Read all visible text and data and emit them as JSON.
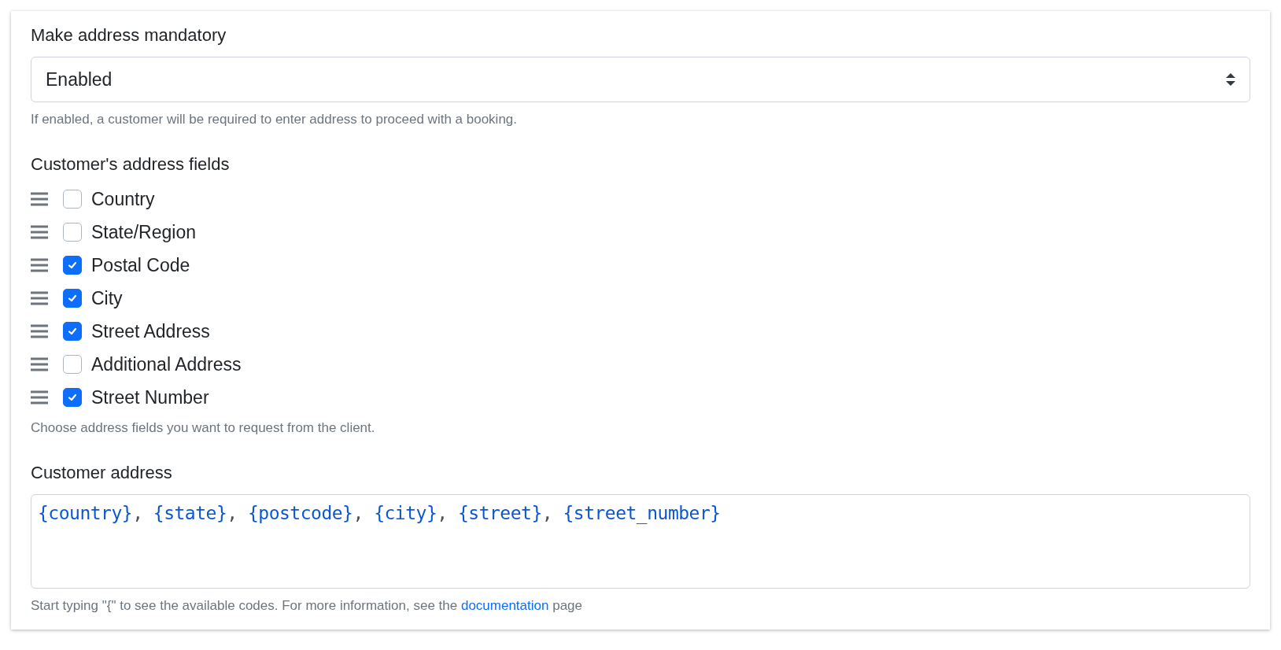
{
  "mandatory": {
    "label": "Make address mandatory",
    "value": "Enabled",
    "help": "If enabled, a customer will be required to enter address to proceed with a booking."
  },
  "fields": {
    "label": "Customer's address fields",
    "items": [
      {
        "label": "Country",
        "checked": false
      },
      {
        "label": "State/Region",
        "checked": false
      },
      {
        "label": "Postal Code",
        "checked": true
      },
      {
        "label": "City",
        "checked": true
      },
      {
        "label": "Street Address",
        "checked": true
      },
      {
        "label": "Additional Address",
        "checked": false
      },
      {
        "label": "Street Number",
        "checked": true
      }
    ],
    "help": "Choose address fields you want to request from the client."
  },
  "address": {
    "label": "Customer address",
    "tokens": [
      "{country}",
      "{state}",
      "{postcode}",
      "{city}",
      "{street}",
      "{street_number}"
    ],
    "separator": ", ",
    "help_before": "Start typing \"{\" to see the available codes. For more information, see the",
    "help_link": "documentation",
    "help_after": "page"
  }
}
